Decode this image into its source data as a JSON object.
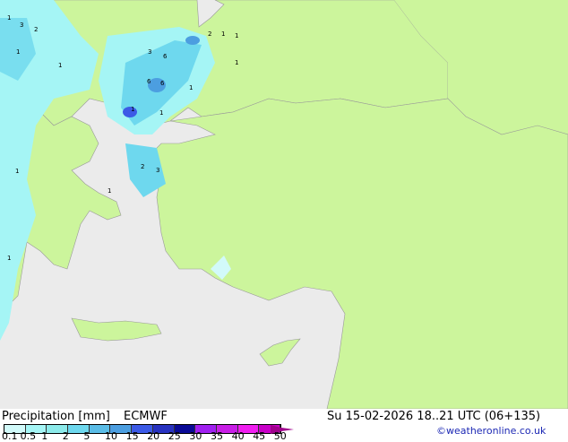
{
  "legend": {
    "title": "Precipitation [mm]",
    "model": "ECMWF",
    "datetime": "Su 15-02-2026 18..21 UTC (06+135)",
    "credit": "©weatheronline.co.uk",
    "ticks": [
      "0.1",
      "0.5",
      "1",
      "2",
      "5",
      "10",
      "15",
      "20",
      "25",
      "30",
      "35",
      "40",
      "45",
      "50"
    ],
    "colors": [
      "#d2fafa",
      "#a5f5f5",
      "#8ceaea",
      "#6ed8ee",
      "#5abce6",
      "#4c9ee0",
      "#3c5ae6",
      "#2832c0",
      "#0a0a96",
      "#a020f0",
      "#c81ee6",
      "#f01ef0",
      "#c800c8"
    ],
    "arrow_color": "#a0008c"
  },
  "map": {
    "land_color": "#ccf59c",
    "sea_color": "#ebebeb",
    "stations": [
      {
        "v": "1"
      },
      {
        "v": "3"
      },
      {
        "v": "2"
      },
      {
        "v": "1"
      },
      {
        "v": "1"
      },
      {
        "v": "2"
      },
      {
        "v": "1"
      },
      {
        "v": "3"
      },
      {
        "v": "6"
      },
      {
        "v": "1"
      },
      {
        "v": "1"
      },
      {
        "v": "6"
      },
      {
        "v": "6"
      },
      {
        "v": "1"
      },
      {
        "v": "1"
      },
      {
        "v": "1"
      },
      {
        "v": "2"
      },
      {
        "v": "3"
      },
      {
        "v": "1"
      },
      {
        "v": "1"
      },
      {
        "v": "1"
      }
    ]
  }
}
